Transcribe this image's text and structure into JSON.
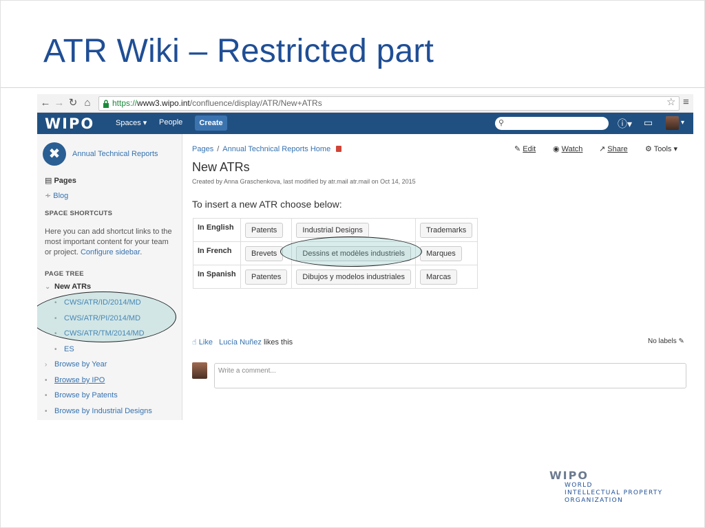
{
  "slide": {
    "title": "ATR Wiki – Restricted part"
  },
  "browser": {
    "url_scheme": "https://",
    "url_host": "www3.wipo.int",
    "url_path": "/confluence/display/ATR/New+ATRs"
  },
  "header": {
    "logo": "WIPO",
    "spaces": "Spaces ▾",
    "people": "People",
    "create": "Create"
  },
  "sidebar": {
    "space_name": "Annual Technical Reports",
    "pages": "Pages",
    "blog": "Blog",
    "shortcuts_head": "SPACE SHORTCUTS",
    "shortcuts_text": "Here you can add shortcut links to the most important content for your team or project.",
    "configure_link": "Configure sidebar",
    "tree_head": "PAGE TREE",
    "tree_root": "New ATRs",
    "tree_items": [
      "CWS/ATR/ID/2014/MD",
      "CWS/ATR/PI/2014/MD",
      "CWS/ATR/TM/2014/MD",
      "ES"
    ],
    "browse_items": [
      "Browse by Year",
      "Browse by IPO",
      "Browse by Patents",
      "Browse by Industrial Designs"
    ]
  },
  "main": {
    "breadcrumb_pages": "Pages",
    "breadcrumb_sep": "/",
    "breadcrumb_home": "Annual Technical Reports Home",
    "actions": {
      "edit": "Edit",
      "watch": "Watch",
      "share": "Share",
      "tools": "Tools ▾"
    },
    "title": "New ATRs",
    "meta": "Created by Anna Graschenkova, last modified by atr.mail atr.mail on Oct 14, 2015",
    "insert_heading": "To insert a new ATR choose below:",
    "rows": [
      {
        "label": "In English",
        "patents": "Patents",
        "designs": "Industrial Designs",
        "marks": "Trademarks"
      },
      {
        "label": "In French",
        "patents": "Brevets",
        "designs": "Dessins et modèles industriels",
        "marks": "Marques"
      },
      {
        "label": "In Spanish",
        "patents": "Patentes",
        "designs": "Dibujos y modelos industriales",
        "marks": "Marcas"
      }
    ],
    "like": "Like",
    "liker": "Lucía Nuñez",
    "likes_this": "likes this",
    "no_labels": "No labels",
    "comment_placeholder": "Write a comment..."
  },
  "footer": {
    "logo": "WIPO",
    "line1": "WORLD",
    "line2": "INTELLECTUAL PROPERTY",
    "line3": "ORGANIZATION"
  }
}
